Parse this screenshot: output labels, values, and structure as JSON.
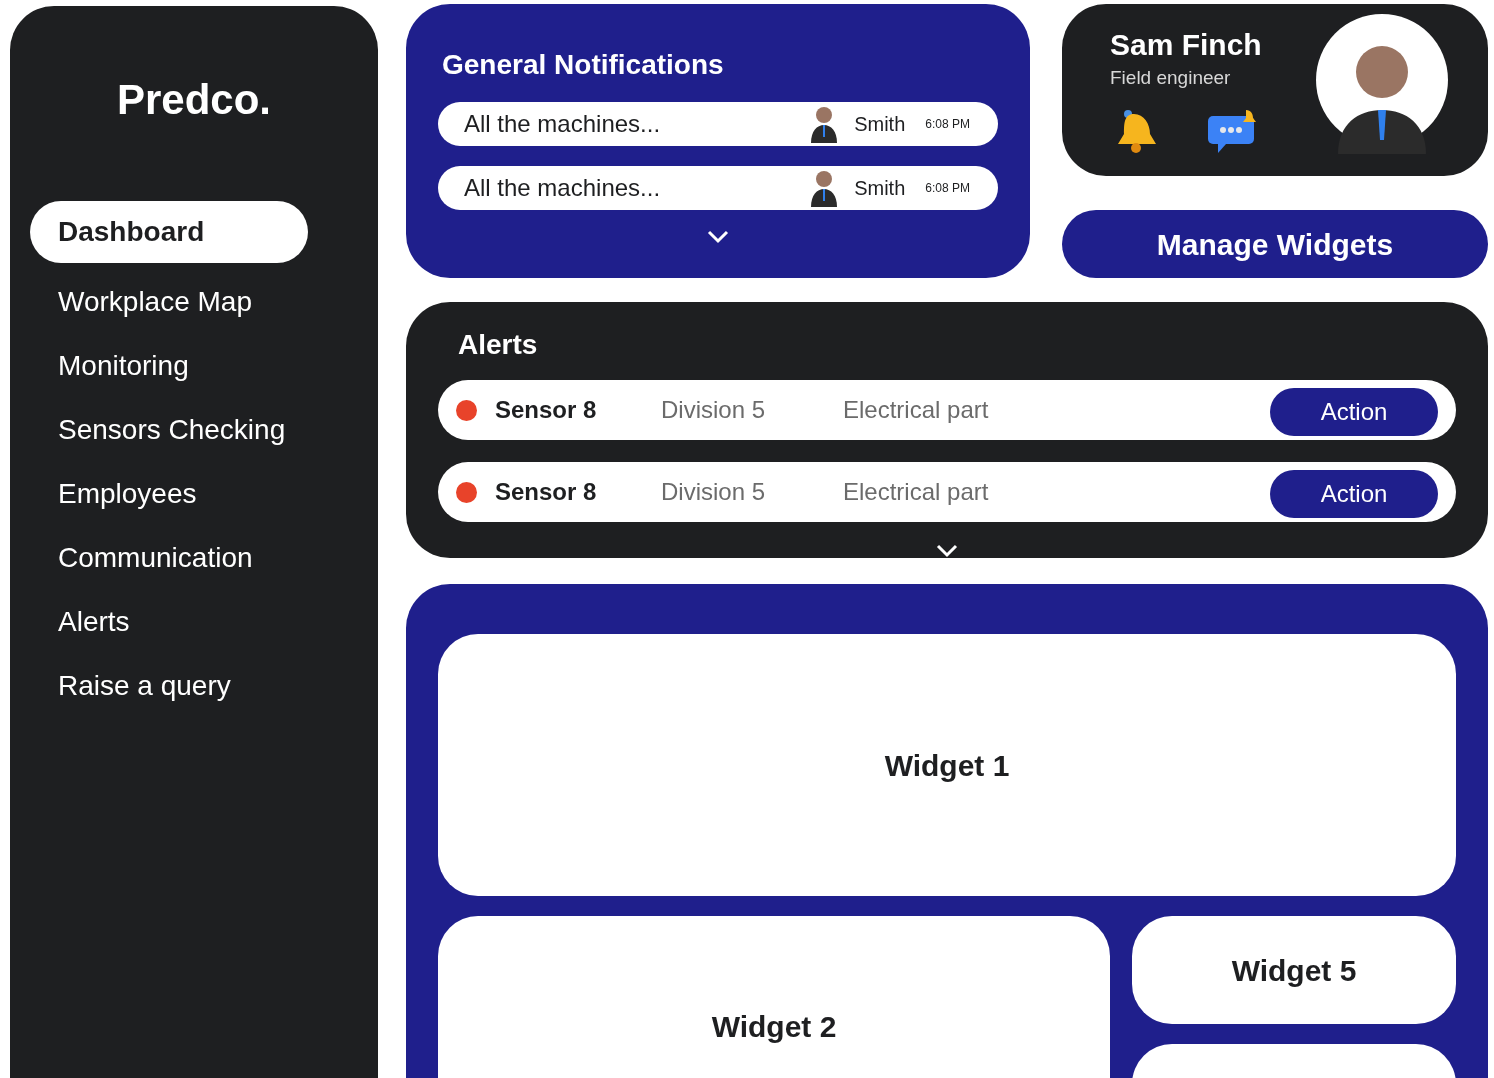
{
  "sidebar": {
    "logo": "Predco.",
    "items": [
      {
        "label": "Dashboard",
        "selected": true
      },
      {
        "label": "Workplace Map",
        "selected": false
      },
      {
        "label": "Monitoring",
        "selected": false
      },
      {
        "label": "Sensors Checking",
        "selected": false
      },
      {
        "label": "Employees",
        "selected": false
      },
      {
        "label": "Communication",
        "selected": false
      },
      {
        "label": "Alerts",
        "selected": false
      },
      {
        "label": "Raise a query",
        "selected": false
      }
    ]
  },
  "notifications": {
    "title": "General Notifications",
    "items": [
      {
        "message": "All the machines...",
        "sender": "Smith",
        "time": "6:08 PM"
      },
      {
        "message": "All the machines...",
        "sender": "Smith",
        "time": "6:08 PM"
      }
    ]
  },
  "profile": {
    "name": "Sam Finch",
    "role": "Field engineer"
  },
  "manage_button": "Manage Widgets",
  "alerts": {
    "title": "Alerts",
    "rows": [
      {
        "sensor": "Sensor 8",
        "division": "Division 5",
        "part": "Electrical part",
        "action": "Action",
        "color": "#e8432a"
      },
      {
        "sensor": "Sensor 8",
        "division": "Division 5",
        "part": "Electrical part",
        "action": "Action",
        "color": "#e8432a"
      }
    ]
  },
  "widgets": [
    {
      "label": "Widget 1"
    },
    {
      "label": "Widget 2"
    },
    {
      "label": "Widget 5"
    }
  ]
}
